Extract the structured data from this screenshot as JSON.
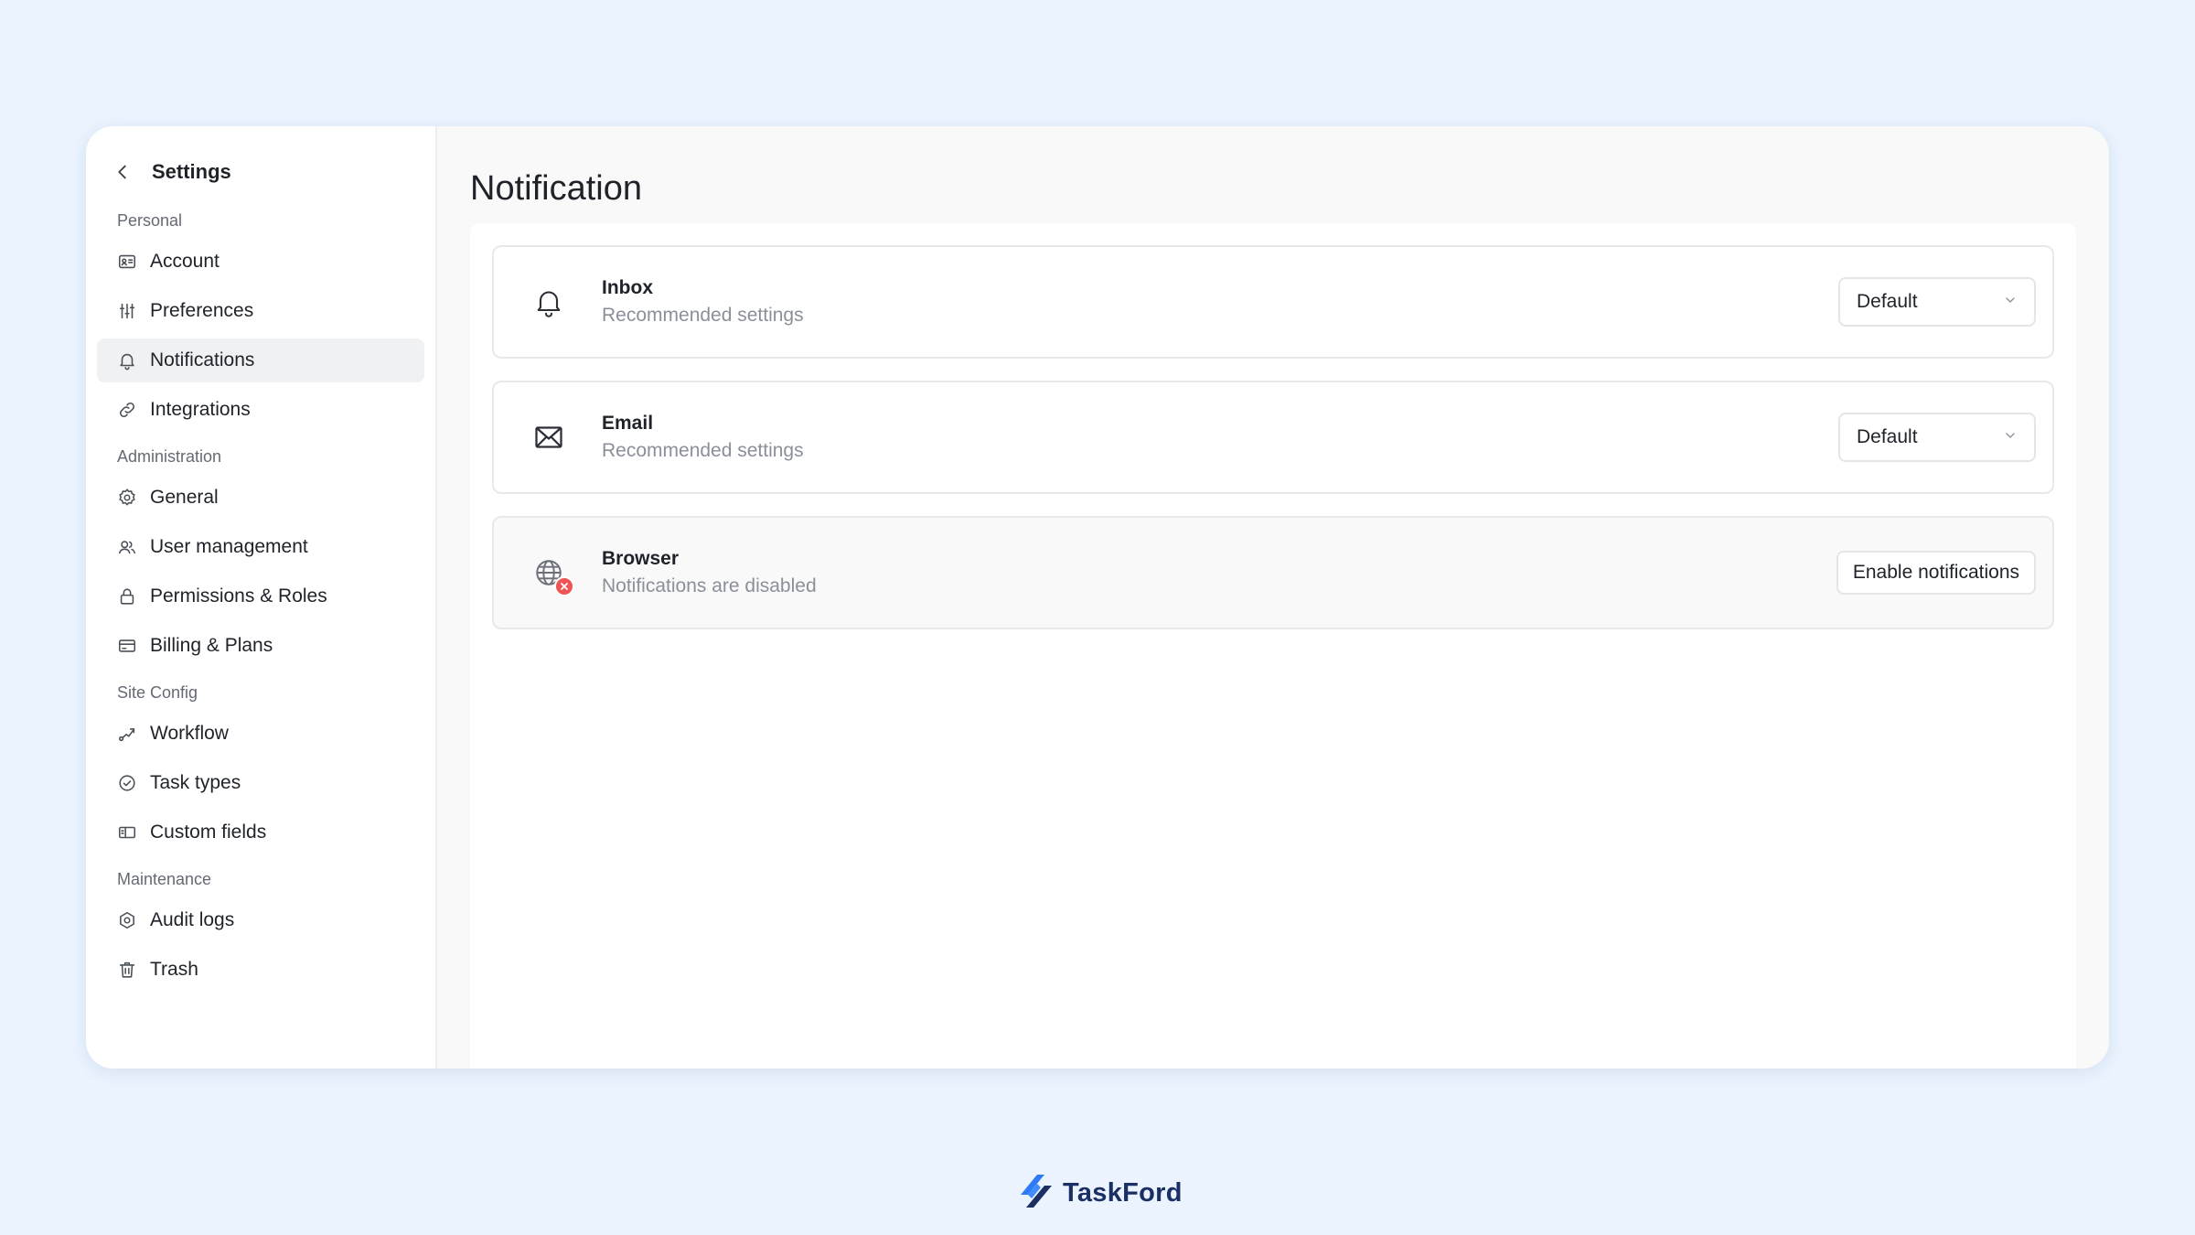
{
  "sidebar": {
    "title": "Settings",
    "sections": [
      {
        "label": "Personal",
        "items": [
          {
            "label": "Account",
            "icon": "id-card-icon"
          },
          {
            "label": "Preferences",
            "icon": "sliders-icon"
          },
          {
            "label": "Notifications",
            "icon": "bell-icon",
            "active": true
          },
          {
            "label": "Integrations",
            "icon": "link-icon"
          }
        ]
      },
      {
        "label": "Administration",
        "items": [
          {
            "label": "General",
            "icon": "gear-icon"
          },
          {
            "label": "User management",
            "icon": "users-icon"
          },
          {
            "label": "Permissions & Roles",
            "icon": "lock-icon"
          },
          {
            "label": "Billing & Plans",
            "icon": "credit-card-icon"
          }
        ]
      },
      {
        "label": "Site Config",
        "items": [
          {
            "label": "Workflow",
            "icon": "workflow-icon"
          },
          {
            "label": "Task types",
            "icon": "check-circle-icon"
          },
          {
            "label": "Custom fields",
            "icon": "custom-fields-icon"
          }
        ]
      },
      {
        "label": "Maintenance",
        "items": [
          {
            "label": "Audit logs",
            "icon": "hexagon-gear-icon"
          },
          {
            "label": "Trash",
            "icon": "trash-icon"
          }
        ]
      }
    ]
  },
  "main": {
    "title": "Notification",
    "channels": [
      {
        "title": "Inbox",
        "subtitle": "Recommended settings",
        "icon": "bell-icon",
        "control": "select",
        "value": "Default"
      },
      {
        "title": "Email",
        "subtitle": "Recommended settings",
        "icon": "envelope-icon",
        "control": "select",
        "value": "Default"
      },
      {
        "title": "Browser",
        "subtitle": "Notifications are disabled",
        "icon": "globe-icon",
        "control": "button",
        "button_label": "Enable notifications"
      }
    ]
  },
  "brand": {
    "name": "TaskFord"
  },
  "colors": {
    "background": "#eaf3fe",
    "active_item": "#f0f1f3",
    "error": "#f05454",
    "brand_dark": "#1b2f64",
    "brand_blue": "#2f7bf5"
  }
}
